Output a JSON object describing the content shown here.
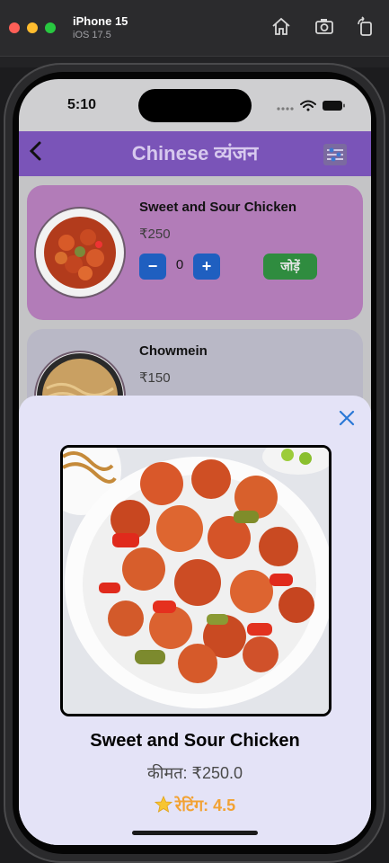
{
  "simulator": {
    "device_name": "iPhone 15",
    "os_version": "iOS 17.5",
    "toolbar_icons": [
      "home-icon",
      "screenshot-icon",
      "rotate-icon"
    ]
  },
  "status_bar": {
    "time": "5:10",
    "icons": [
      "cellular-icon",
      "wifi-icon",
      "battery-icon"
    ]
  },
  "nav": {
    "title": "Chinese व्यंजन",
    "back_icon": "chevron-left-icon",
    "filter_icon": "filter-icon"
  },
  "menu_items": [
    {
      "name": "Sweet and Sour Chicken",
      "price": "₹250",
      "quantity": "0",
      "minus_label": "−",
      "plus_label": "+",
      "add_label": "जोड़ें"
    },
    {
      "name": "Chowmein",
      "price": "₹150"
    }
  ],
  "detail_sheet": {
    "name": "Sweet and Sour Chicken",
    "price": "कीमत: ₹250.0",
    "rating": "रेटिंग: 4.5",
    "rating_value": 4.5,
    "close_icon": "close-icon",
    "rating_icon": "star-icon"
  },
  "colors": {
    "nav_bar": "#7a54b8",
    "card_selected": "#b27cb8",
    "card": "#b9b8c6",
    "stepper_button": "#1f5fc0",
    "add_button": "#2f8c3f",
    "sheet_background": "#e4e3f7",
    "rating_text": "#f2a233",
    "close_icon": "#2a78d6"
  }
}
